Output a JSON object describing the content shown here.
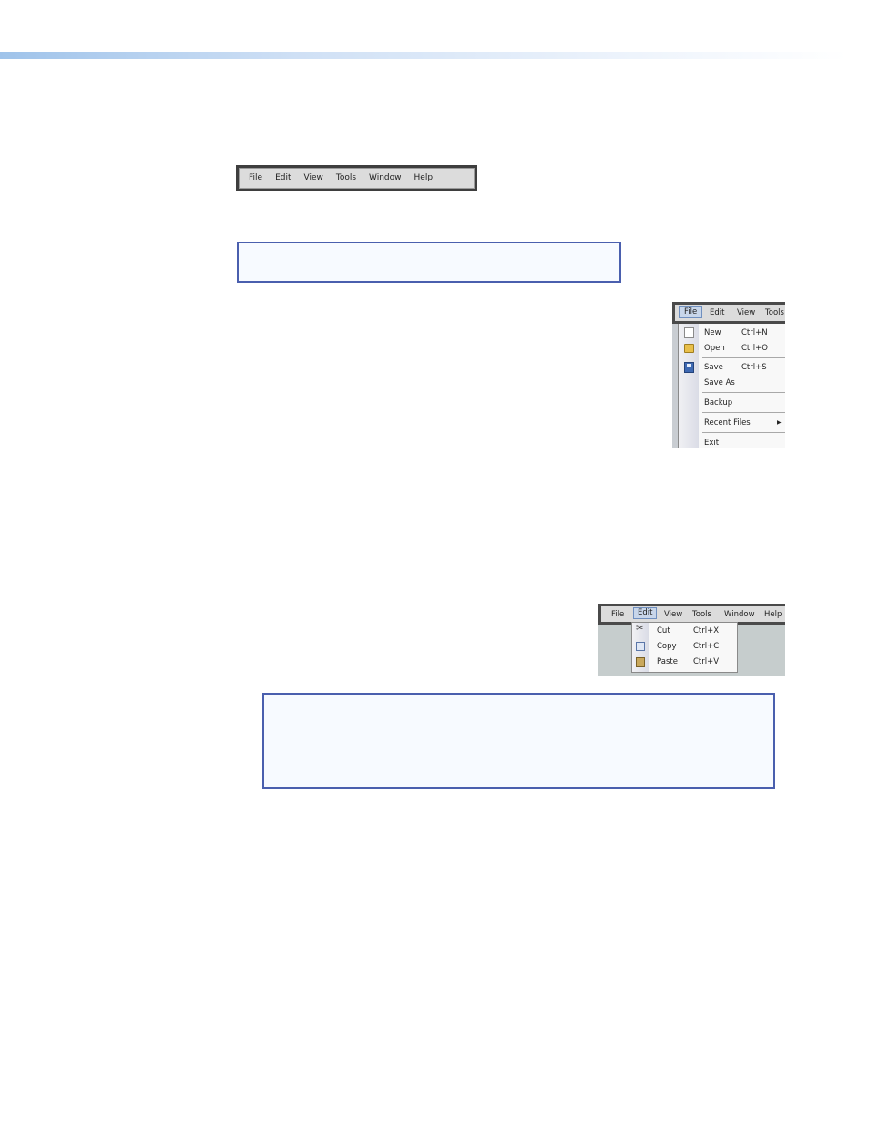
{
  "main_menubar": {
    "items": [
      "File",
      "Edit",
      "View",
      "Tools",
      "Window",
      "Help"
    ]
  },
  "file_menu_shot": {
    "bar_items": [
      "File",
      "Edit",
      "View",
      "Tools"
    ],
    "active": "File",
    "items": [
      {
        "label": "New",
        "shortcut": "Ctrl+N",
        "icon": "new-document-icon"
      },
      {
        "label": "Open",
        "shortcut": "Ctrl+O",
        "icon": "open-folder-icon"
      },
      {
        "label": "Save",
        "shortcut": "Ctrl+S",
        "icon": "save-disk-icon"
      },
      {
        "label": "Save As",
        "shortcut": ""
      },
      {
        "label": "Backup",
        "shortcut": ""
      },
      {
        "label": "Recent Files",
        "shortcut": "",
        "submenu": true
      },
      {
        "label": "Exit",
        "shortcut": ""
      }
    ]
  },
  "edit_menu_shot": {
    "bar_items": [
      "File",
      "Edit",
      "View",
      "Tools",
      "Window",
      "Help"
    ],
    "active": "Edit",
    "items": [
      {
        "label": "Cut",
        "shortcut": "Ctrl+X",
        "icon": "scissors-icon"
      },
      {
        "label": "Copy",
        "shortcut": "Ctrl+C",
        "icon": "copy-icon"
      },
      {
        "label": "Paste",
        "shortcut": "Ctrl+V",
        "icon": "clipboard-icon"
      }
    ]
  },
  "colors": {
    "note_border": "#4a5fae",
    "menu_highlight": "#c8d6ea"
  }
}
